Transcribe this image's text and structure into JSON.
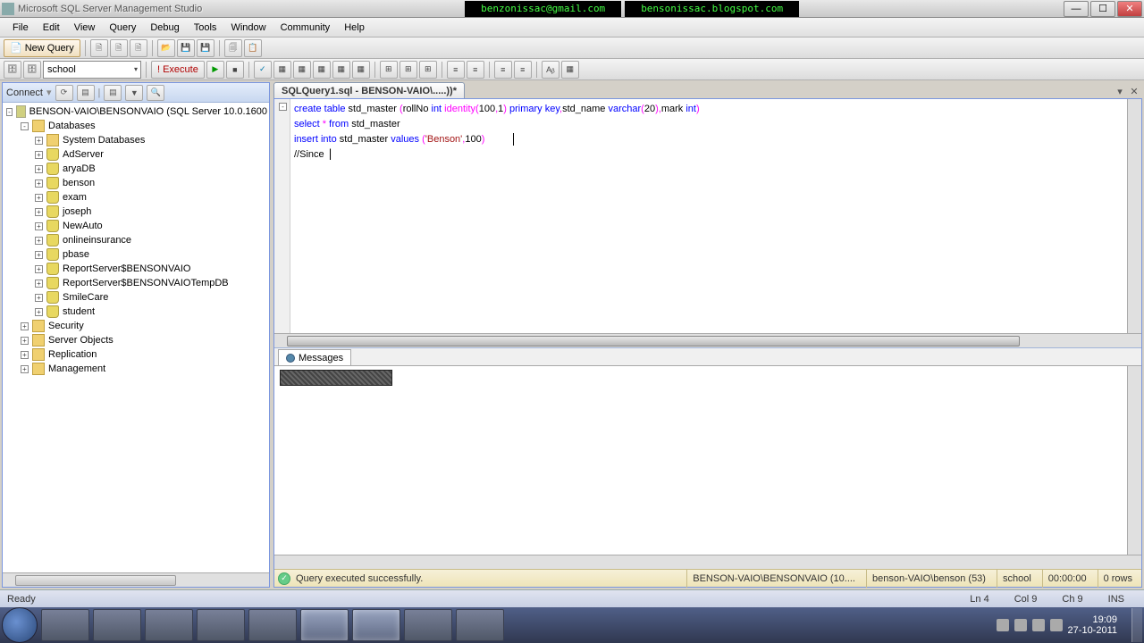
{
  "titlebar": {
    "app_title": "Microsoft SQL Server Management Studio",
    "banner_email": "benzonissac@gmail.com",
    "banner_url": "bensonissac.blogspot.com"
  },
  "menu": [
    "File",
    "Edit",
    "View",
    "Query",
    "Debug",
    "Tools",
    "Window",
    "Community",
    "Help"
  ],
  "toolbar1": {
    "new_query": "New Query"
  },
  "toolbar2": {
    "db_dropdown": "school",
    "execute": "Execute"
  },
  "object_explorer": {
    "connect_label": "Connect",
    "root": "BENSON-VAIO\\BENSONVAIO (SQL Server 10.0.1600",
    "databases_label": "Databases",
    "sysdb": "System Databases",
    "dbs": [
      "AdServer",
      "aryaDB",
      "benson",
      "exam",
      "joseph",
      "NewAuto",
      "onlineinsurance",
      "pbase",
      "ReportServer$BENSONVAIO",
      "ReportServer$BENSONVAIOTempDB",
      "SmileCare",
      "student"
    ],
    "folders": [
      "Security",
      "Server Objects",
      "Replication",
      "Management"
    ]
  },
  "document": {
    "tab_title": "SQLQuery1.sql - BENSON-VAIO\\.....))*",
    "code": {
      "l1a": "create",
      "l1b": " table",
      "l1c": " std_master ",
      "l1d": "(",
      "l1e": "rollNo ",
      "l1f": "int",
      "l1g": " identity",
      "l1h": "(",
      "l1i": "100",
      "l1j": ",",
      "l1k": "1",
      "l1l": ")",
      "l1m": " primary",
      "l1n": " key",
      "l1o": ",",
      "l1p": "std_name ",
      "l1q": "varchar",
      "l1r": "(",
      "l1s": "20",
      "l1t": ")",
      "l1u": ",",
      "l1v": "mark ",
      "l1w": "int",
      "l1x": ")",
      "l2a": "select",
      "l2b": " *",
      "l2c": " from",
      "l2d": " std_master",
      "l3a": "insert",
      "l3b": " into",
      "l3c": " std_master ",
      "l3d": "values",
      "l3e": " (",
      "l3f": "'Benson'",
      "l3g": ",",
      "l3h": "100",
      "l3i": ")",
      "l4a": "//Since "
    }
  },
  "messages": {
    "tab": "Messages"
  },
  "result_status": {
    "msg": "Query executed successfully.",
    "server": "BENSON-VAIO\\BENSONVAIO (10....",
    "login": "benson-VAIO\\benson (53)",
    "db": "school",
    "elapsed": "00:00:00",
    "rows": "0 rows"
  },
  "statusbar": {
    "ready": "Ready",
    "ln": "Ln 4",
    "col": "Col 9",
    "ch": "Ch 9",
    "ins": "INS"
  },
  "tray": {
    "time": "19:09",
    "date": "27-10-2011"
  }
}
